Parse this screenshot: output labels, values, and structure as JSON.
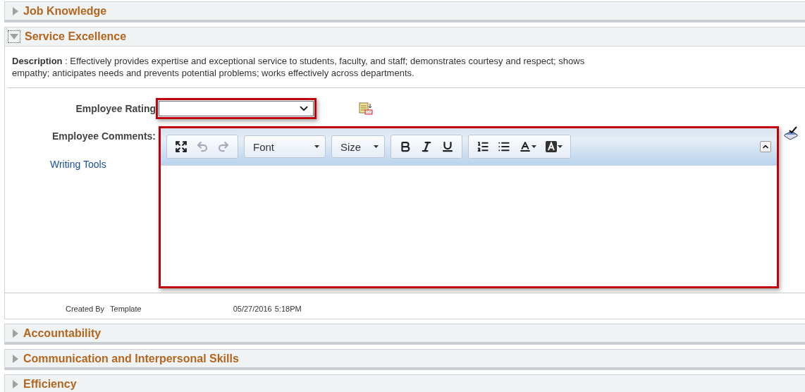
{
  "sections": [
    {
      "title": "Job Knowledge",
      "expanded": false
    },
    {
      "title": "Service Excellence",
      "expanded": true,
      "description_label": "Description",
      "description": " : Effectively provides expertise and exceptional service to students, faculty, and staff; demonstrates courtesy and respect; shows empathy; anticipates needs and prevents potential problems; works effectively across departments.",
      "rating_label": "Employee Rating",
      "comments_label": "Employee Comments:",
      "writing_tools": "Writing Tools",
      "editor": {
        "font": "Font",
        "size": "Size"
      },
      "created_by_label": "Created By",
      "created_by": "Template",
      "created_date": "05/27/2016",
      "created_time": "5:18PM"
    },
    {
      "title": "Accountability",
      "expanded": false
    },
    {
      "title": "Communication and Interpersonal Skills",
      "expanded": false
    },
    {
      "title": "Efficiency",
      "expanded": false
    }
  ]
}
